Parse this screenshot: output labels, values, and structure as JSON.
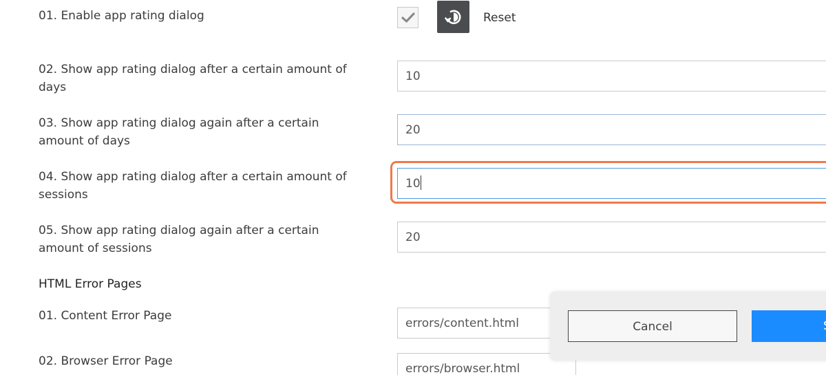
{
  "settings": {
    "enable_label": "01. Enable app rating dialog",
    "enable_checked": true,
    "reset_label": "Reset",
    "rows": [
      {
        "label": "02. Show app rating dialog after a certain amount of days",
        "value": "10"
      },
      {
        "label": "03. Show app rating dialog again after a certain amount of days",
        "value": "20"
      },
      {
        "label": "04. Show app rating dialog after a certain amount of sessions",
        "value": "10"
      },
      {
        "label": "05. Show app rating dialog again after a certain amount of sessions",
        "value": "20"
      }
    ]
  },
  "error_pages": {
    "title": "HTML Error Pages",
    "rows": [
      {
        "label": "01. Content Error Page",
        "value": "errors/content.html"
      },
      {
        "label": "02. Browser Error Page",
        "value": "errors/browser.html"
      }
    ]
  },
  "actions": {
    "cancel_label": "Cancel",
    "save_label": "S"
  },
  "colors": {
    "accent": "#1a8cff",
    "highlight": "#f0784a",
    "icon_button_bg": "#4a4c4f"
  },
  "icons": {
    "checkbox": "check-icon",
    "reset": "reset-icon"
  }
}
